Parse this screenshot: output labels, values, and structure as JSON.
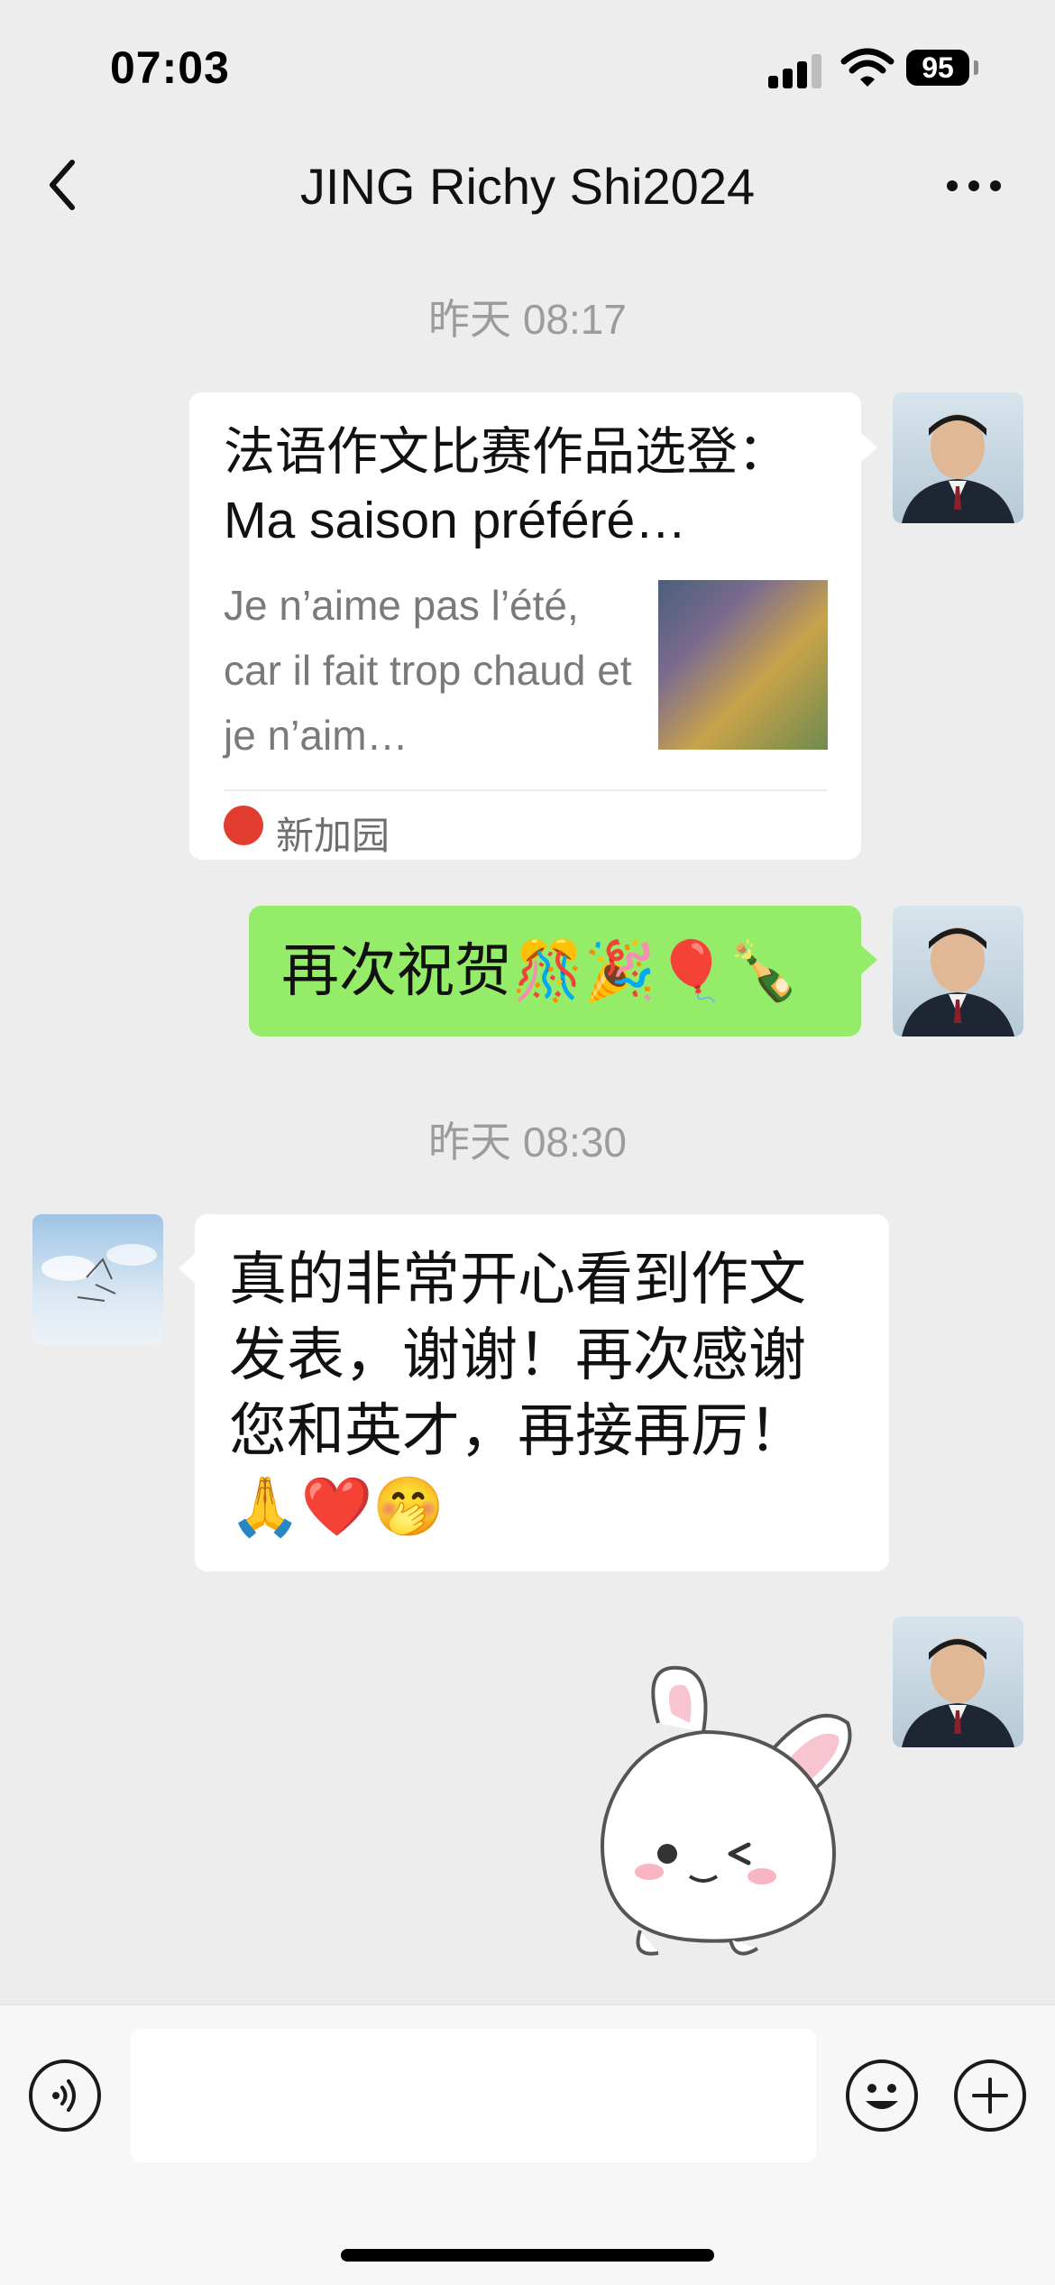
{
  "status_bar": {
    "time": "07:03",
    "battery": "95"
  },
  "header": {
    "title": "JING Richy Shi2024"
  },
  "messages": [
    {
      "timestamp": "昨天 08:17"
    },
    {
      "card": {
        "title": "法语作文比赛作品选登：Ma saison préféré…",
        "desc": "Je n’aime pas l’été, car il fait trop chaud et je n’aim…",
        "source": "新加园"
      }
    },
    {
      "text": "再次祝贺🎊🎉🎈🍾"
    },
    {
      "timestamp": "昨天 08:30"
    },
    {
      "text": "真的非常开心看到作文发表，谢谢！再次感谢您和英才，再接再厉！🙏❤️🤭"
    },
    {
      "sticker": "bunny-sticker"
    }
  ],
  "icons": {
    "back": "chevron-left-icon",
    "more": "more-dots-icon",
    "voice": "voice-icon",
    "emoji": "emoji-icon",
    "add": "plus-icon"
  },
  "colors": {
    "background": "#ededed",
    "bubble_green": "#95ec69",
    "bubble_white": "#ffffff"
  }
}
